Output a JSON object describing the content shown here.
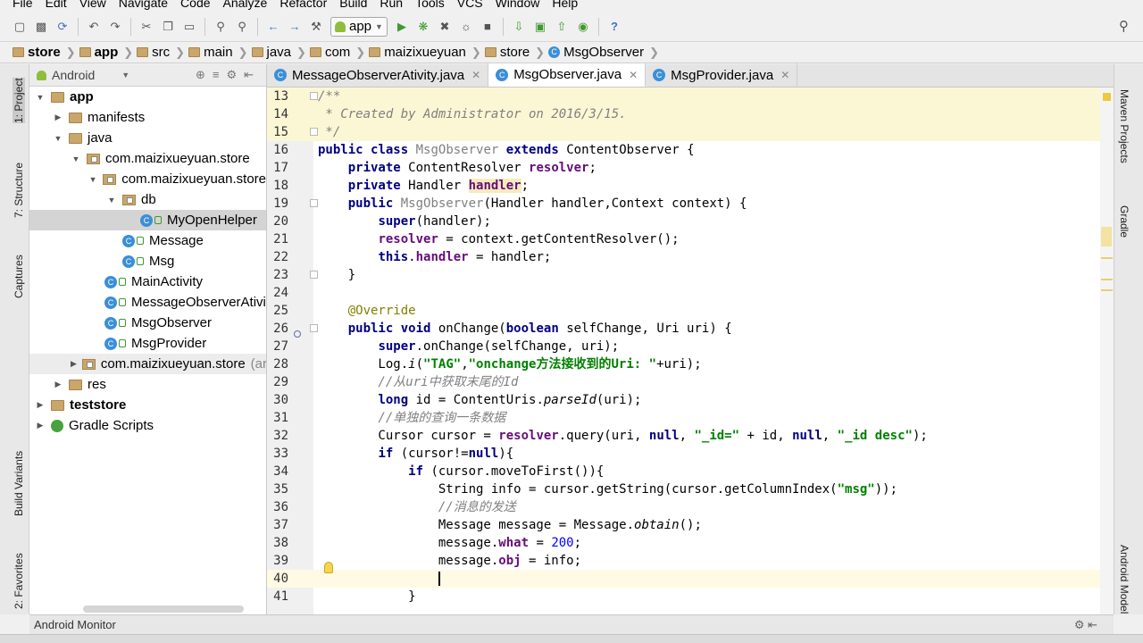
{
  "menu": [
    "File",
    "Edit",
    "View",
    "Navigate",
    "Code",
    "Analyze",
    "Refactor",
    "Build",
    "Run",
    "Tools",
    "VCS",
    "Window",
    "Help"
  ],
  "toolbar": {
    "run_config": "app",
    "help_icon": "?"
  },
  "breadcrumb": [
    "store",
    "app",
    "src",
    "main",
    "java",
    "com",
    "maizixueyuan",
    "store",
    "MsgObserver"
  ],
  "left_strip": {
    "project": "1: Project",
    "structure": "7: Structure",
    "captures": "Captures",
    "build_variants": "Build Variants",
    "favorites": "2: Favorites"
  },
  "right_strip": {
    "maven": "Maven Projects",
    "gradle": "Gradle",
    "android_model": "Android Model"
  },
  "project_panel": {
    "view_mode": "Android",
    "tree": [
      {
        "label": "app",
        "level": 0,
        "icon": "folder",
        "expanded": true,
        "bold": true
      },
      {
        "label": "manifests",
        "level": 1,
        "icon": "folder",
        "expanded": false
      },
      {
        "label": "java",
        "level": 1,
        "icon": "folder",
        "expanded": true
      },
      {
        "label": "com.maizixueyuan.store",
        "level": 2,
        "icon": "package",
        "expanded": true
      },
      {
        "label": "com.maizixueyuan.store",
        "level": 3,
        "icon": "package",
        "expanded": true
      },
      {
        "label": "db",
        "level": 4,
        "icon": "package",
        "expanded": true
      },
      {
        "label": "MyOpenHelper",
        "level": 5,
        "icon": "class",
        "selected": true
      },
      {
        "label": "Message",
        "level": 4,
        "icon": "class"
      },
      {
        "label": "Msg",
        "level": 4,
        "icon": "class"
      },
      {
        "label": "MainActivity",
        "level": 3,
        "icon": "class"
      },
      {
        "label": "MessageObserverAtivi",
        "level": 3,
        "icon": "class"
      },
      {
        "label": "MsgObserver",
        "level": 3,
        "icon": "class"
      },
      {
        "label": "MsgProvider",
        "level": 3,
        "icon": "class"
      },
      {
        "label": "com.maizixueyuan.store",
        "suffix": "(ar",
        "level": 2,
        "icon": "package",
        "expanded": false,
        "highlight": true
      },
      {
        "label": "res",
        "level": 1,
        "icon": "folder",
        "expanded": false
      },
      {
        "label": "teststore",
        "level": 0,
        "icon": "folder",
        "expanded": false,
        "bold": true
      },
      {
        "label": "Gradle Scripts",
        "level": 0,
        "icon": "gradle",
        "expanded": false
      }
    ]
  },
  "tabs": [
    {
      "label": "MessageObserverAtivity.java",
      "active": false
    },
    {
      "label": "MsgObserver.java",
      "active": true
    },
    {
      "label": "MsgProvider.java",
      "active": false
    }
  ],
  "editor": {
    "lines": [
      {
        "n": "13",
        "code": "/**"
      },
      {
        "n": "14",
        "code": " * Created by Administrator on 2016/3/15."
      },
      {
        "n": "15",
        "code": " */"
      },
      {
        "n": "16",
        "code": "public class MsgObserver extends ContentObserver {"
      },
      {
        "n": "17",
        "code": "    private ContentResolver resolver;"
      },
      {
        "n": "18",
        "code": "    private Handler handler;"
      },
      {
        "n": "19",
        "code": "    public MsgObserver(Handler handler,Context context) {"
      },
      {
        "n": "20",
        "code": "        super(handler);"
      },
      {
        "n": "21",
        "code": "        resolver = context.getContentResolver();"
      },
      {
        "n": "22",
        "code": "        this.handler = handler;"
      },
      {
        "n": "23",
        "code": "    }"
      },
      {
        "n": "24",
        "code": ""
      },
      {
        "n": "25",
        "code": "    @Override"
      },
      {
        "n": "26",
        "code": "    public void onChange(boolean selfChange, Uri uri) {"
      },
      {
        "n": "27",
        "code": "        super.onChange(selfChange, uri);"
      },
      {
        "n": "28",
        "code": "        Log.i(\"TAG\",\"onchange方法接收到的Uri: \"+uri);"
      },
      {
        "n": "29",
        "code": "        //从uri中获取末尾的Id"
      },
      {
        "n": "30",
        "code": "        long id = ContentUris.parseId(uri);"
      },
      {
        "n": "31",
        "code": "        //单独的查询一条数据"
      },
      {
        "n": "32",
        "code": "        Cursor cursor = resolver.query(uri, null, \"_id=\" + id, null, \"_id desc\");"
      },
      {
        "n": "33",
        "code": "        if (cursor!=null){"
      },
      {
        "n": "34",
        "code": "            if (cursor.moveToFirst()){"
      },
      {
        "n": "35",
        "code": "                String info = cursor.getString(cursor.getColumnIndex(\"msg\"));"
      },
      {
        "n": "36",
        "code": "                //消息的发送"
      },
      {
        "n": "37",
        "code": "                Message message = Message.obtain();"
      },
      {
        "n": "38",
        "code": "                message.what = 200;"
      },
      {
        "n": "39",
        "code": "                message.obj = info;"
      },
      {
        "n": "40",
        "code": "                "
      },
      {
        "n": "41",
        "code": "            }"
      }
    ]
  },
  "bottom": {
    "monitor_label": "Android Monitor"
  }
}
